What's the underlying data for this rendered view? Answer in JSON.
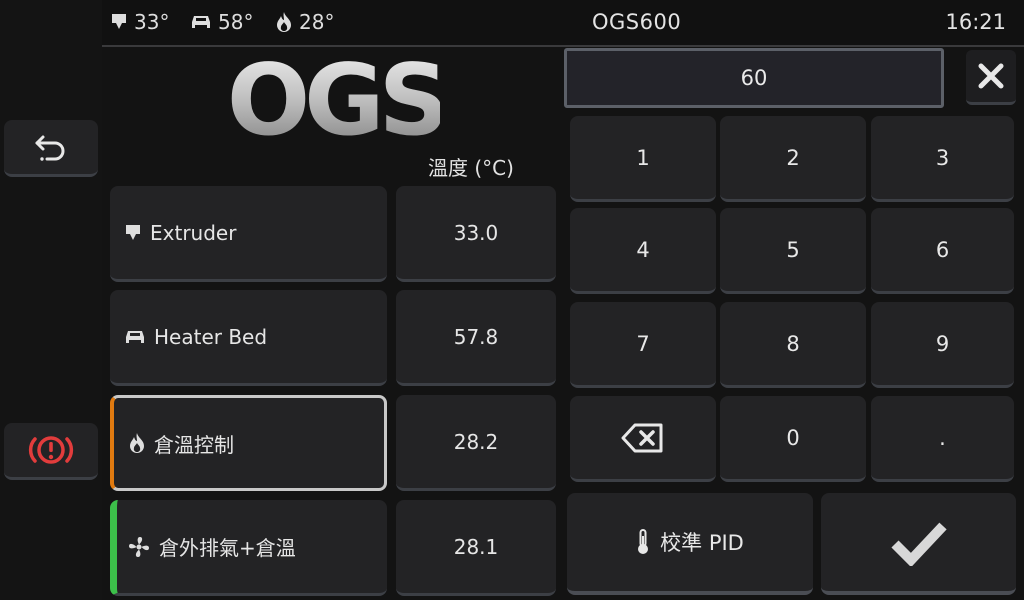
{
  "topbar": {
    "extruder_temp": "33°",
    "bed_temp": "58°",
    "chamber_temp": "28°",
    "title": "OGS600",
    "time": "16:21"
  },
  "logo_text": "OGS",
  "table": {
    "unit_header": "溫度 (°C)",
    "rows": [
      {
        "name": "Extruder",
        "value": "33.0",
        "icon": "extruder-icon"
      },
      {
        "name": "Heater Bed",
        "value": "57.8",
        "icon": "bed-icon"
      },
      {
        "name": "倉溫控制",
        "value": "28.2",
        "icon": "flame-icon"
      },
      {
        "name": "倉外排氣+倉溫",
        "value": "28.1",
        "icon": "fan-icon"
      }
    ]
  },
  "keypad": {
    "display_value": "60",
    "keys": [
      "1",
      "2",
      "3",
      "4",
      "5",
      "6",
      "7",
      "8",
      "9",
      "0",
      "."
    ],
    "pid_label": "校準 PID"
  },
  "colors": {
    "accent_orange": "#e07a10",
    "accent_green": "#3cc04a",
    "danger_red": "#e23c3c",
    "selected_border": "#c8c8c8"
  }
}
